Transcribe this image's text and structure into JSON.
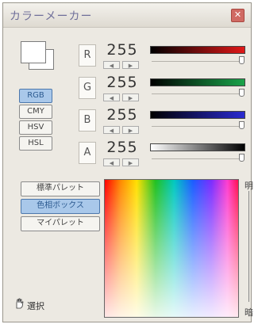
{
  "window": {
    "title": "カラーメーカー",
    "close_glyph": "✕"
  },
  "modes": [
    {
      "label": "RGB",
      "active": true
    },
    {
      "label": "CMY",
      "active": false
    },
    {
      "label": "HSV",
      "active": false
    },
    {
      "label": "HSL",
      "active": false
    }
  ],
  "channels": [
    {
      "label": "R",
      "value": "255",
      "gradient": [
        "#000000",
        "#e01818"
      ]
    },
    {
      "label": "G",
      "value": "255",
      "gradient": [
        "#000000",
        "#1aa34a"
      ]
    },
    {
      "label": "B",
      "value": "255",
      "gradient": [
        "#000000",
        "#2a2ad0"
      ]
    },
    {
      "label": "A",
      "value": "255",
      "gradient": [
        "#ffffff",
        "#000000"
      ]
    }
  ],
  "stepper": {
    "down": "◀",
    "up": "▶"
  },
  "palette_buttons": [
    {
      "label": "標準パレット",
      "active": false
    },
    {
      "label": "色相ボックス",
      "active": true
    },
    {
      "label": "マイパレット",
      "active": false
    }
  ],
  "palette_side": {
    "top": "明",
    "bottom": "暗"
  },
  "select_label": "選択"
}
